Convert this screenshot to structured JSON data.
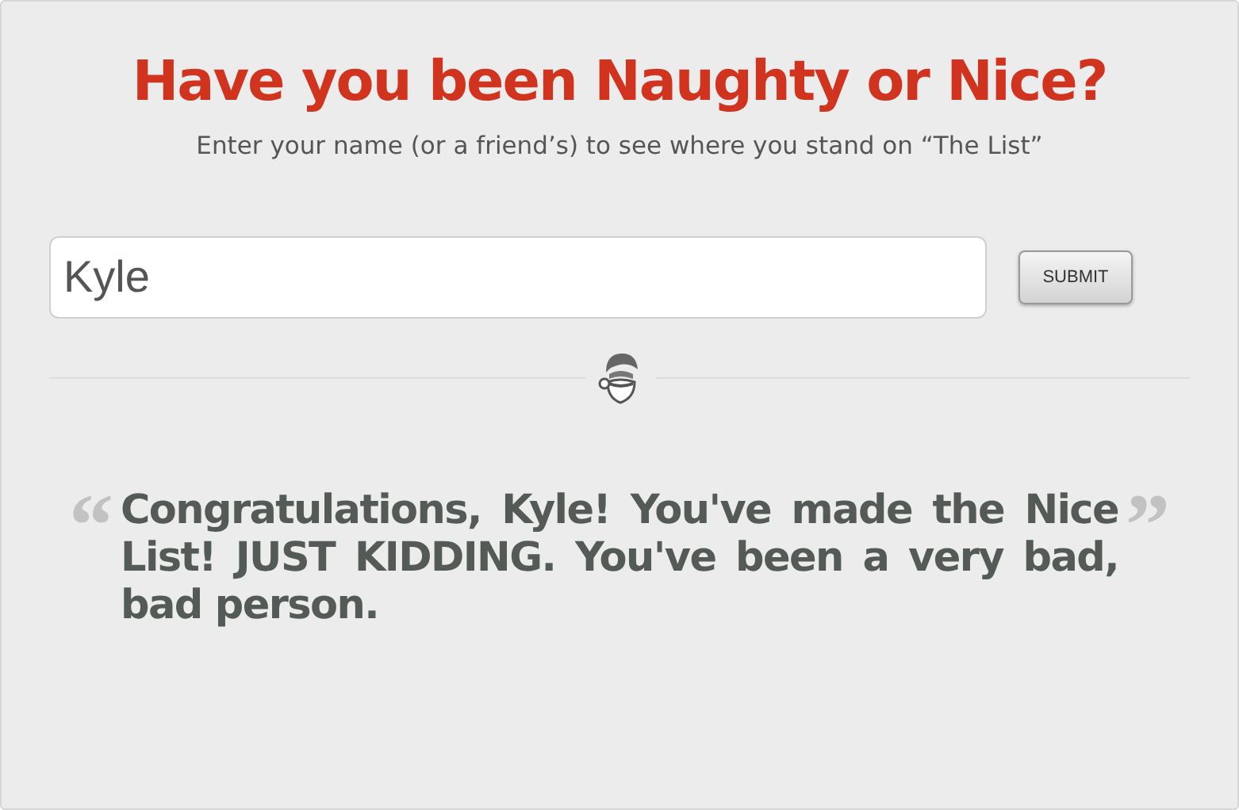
{
  "title": "Have you been Naughty or Nice?",
  "subtitle": "Enter your name (or a friend’s) to see where you stand on “The List”",
  "name_field": {
    "value": "Kyle"
  },
  "submit_button": "SUBMIT",
  "result": {
    "open_quote": "“",
    "text": "Congratulations, Kyle! You've made the Nice List! JUST KIDDING. You've been a very bad, bad person.",
    "close_quote": "”"
  }
}
